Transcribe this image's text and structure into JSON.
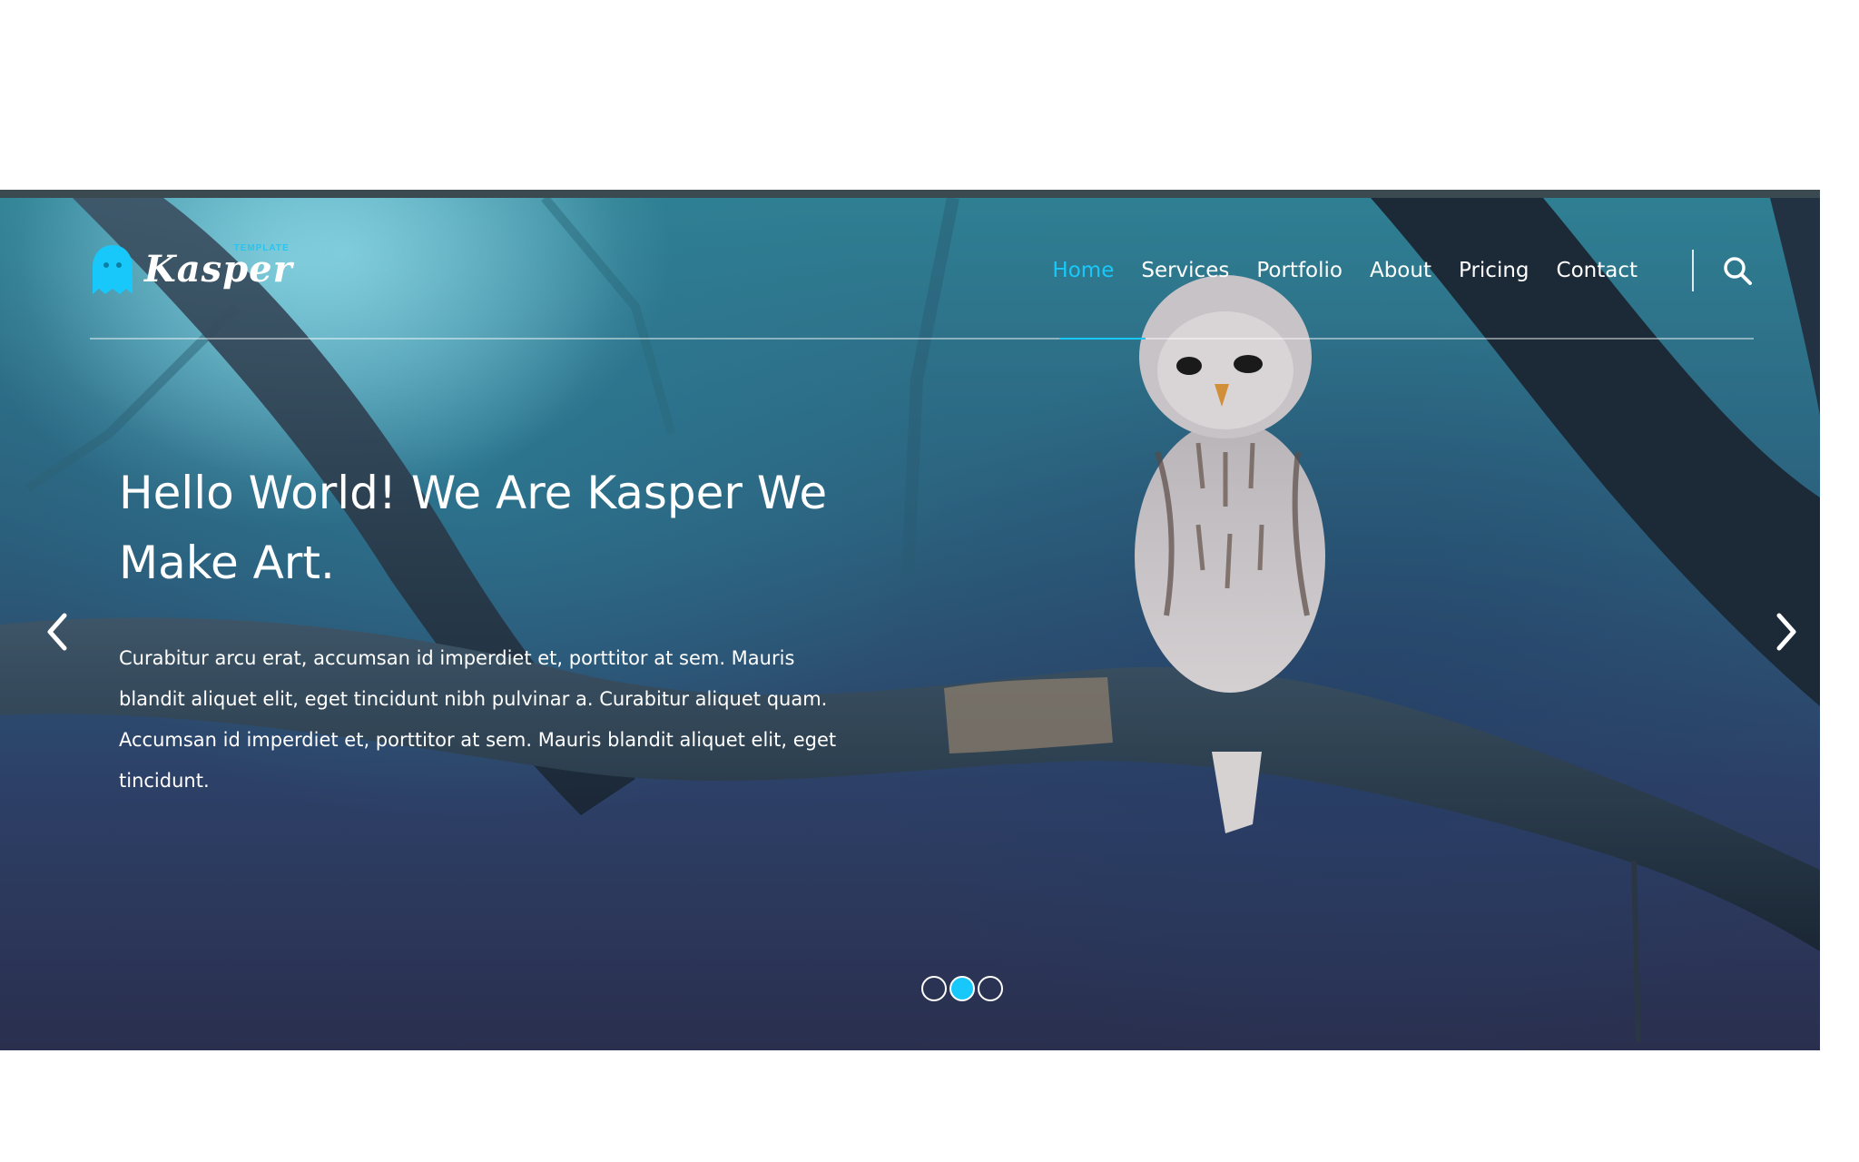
{
  "brand": {
    "name": "Kasper",
    "tagline": "TEMPLATE",
    "accent_color": "#19c8fa",
    "logo_icon": "ghost-icon"
  },
  "nav": {
    "items": [
      {
        "label": "Home",
        "active": true
      },
      {
        "label": "Services",
        "active": false
      },
      {
        "label": "Portfolio",
        "active": false
      },
      {
        "label": "About",
        "active": false
      },
      {
        "label": "Pricing",
        "active": false
      },
      {
        "label": "Contact",
        "active": false
      }
    ],
    "search_icon": "search-icon"
  },
  "hero": {
    "title": "Hello World! We Are Kasper We Make Art.",
    "text": "Curabitur arcu erat, accumsan id imperdiet et, porttitor at sem. Mauris blandit aliquet elit, eget tincidunt nibh pulvinar a. Curabitur aliquet quam. Accumsan id imperdiet et, porttitor at sem. Mauris blandit aliquet elit, eget tincidunt.",
    "prev_icon": "chevron-left-icon",
    "next_icon": "chevron-right-icon"
  },
  "slider": {
    "total_slides": 3,
    "active_slide": 2
  }
}
